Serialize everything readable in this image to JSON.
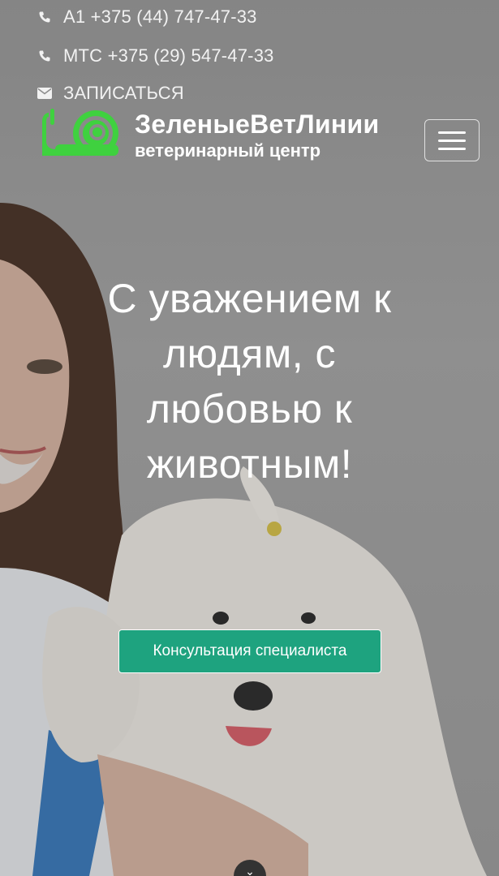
{
  "contacts": [
    {
      "icon": "phone-icon",
      "text": "A1 +375 (44) 747-47-33"
    },
    {
      "icon": "phone-icon",
      "text": "МТС +375 (29) 547-47-33"
    },
    {
      "icon": "envelope-icon",
      "text": "ЗАПИСАТЬСЯ"
    }
  ],
  "brand": {
    "title": "ЗеленыеВетЛинии",
    "subtitle": "ветеринарный центр",
    "logo_icon": "snail-logo-icon",
    "logo_color": "#3fd13f"
  },
  "menu": {
    "icon": "hamburger-menu-icon"
  },
  "hero": {
    "headline": "С уважением к людям, с любовью к животным!",
    "cta_label": "Консультация специалиста",
    "cta_color": "#1ea37f"
  },
  "scroll": {
    "icon": "chevron-down-icon",
    "glyph": "⌄"
  }
}
